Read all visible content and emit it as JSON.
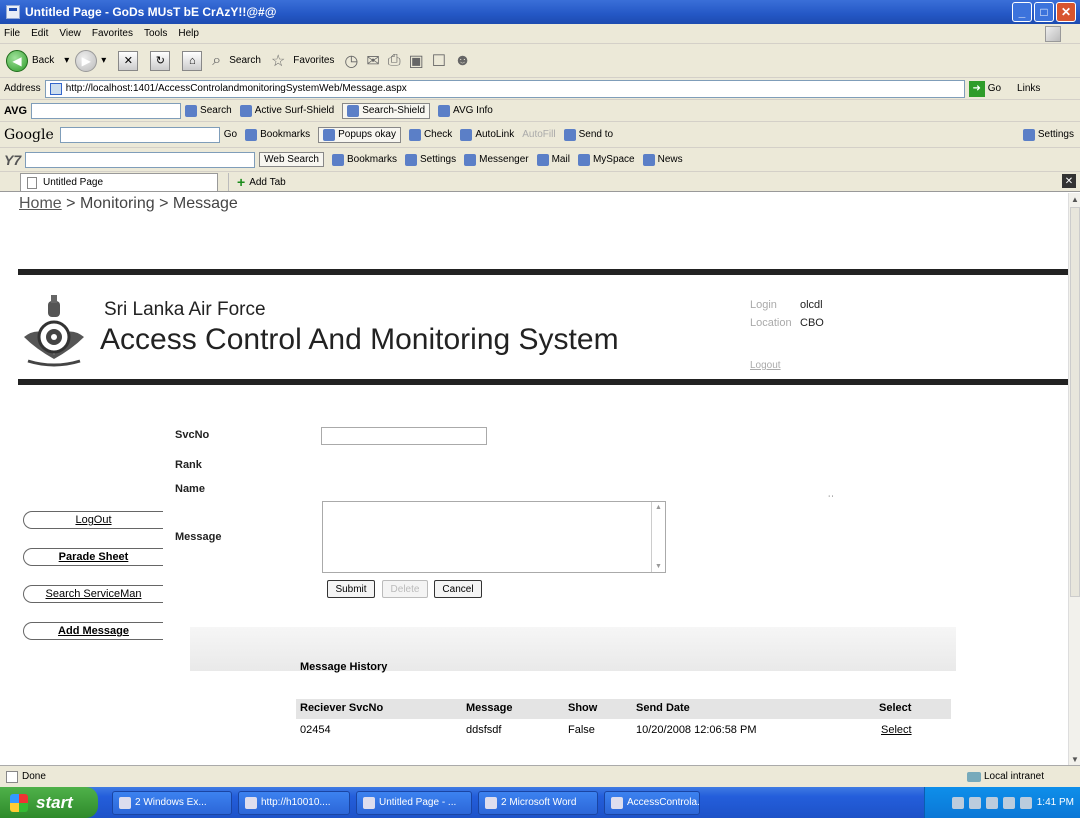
{
  "window": {
    "title": "Untitled Page - GoDs MUsT bE CrAzY!!@#@"
  },
  "menu": [
    "File",
    "Edit",
    "View",
    "Favorites",
    "Tools",
    "Help"
  ],
  "toolbar": {
    "back": "Back",
    "search": "Search",
    "favorites": "Favorites"
  },
  "address": {
    "label": "Address",
    "url": "http://localhost:1401/AccessControlandmonitoringSystemWeb/Message.aspx",
    "go": "Go",
    "links": "Links"
  },
  "avg_bar": {
    "logo": "AVG",
    "search": "Search",
    "active_surf": "Active Surf-Shield",
    "search_shield": "Search-Shield",
    "avg_info": "AVG Info"
  },
  "google_bar": {
    "logo": "Google",
    "go": "Go",
    "bookmarks": "Bookmarks",
    "popups": "Popups okay",
    "check": "Check",
    "autolink": "AutoLink",
    "autofill": "AutoFill",
    "send_to": "Send to",
    "settings": "Settings"
  },
  "yahoo_bar": {
    "web_search": "Web Search",
    "bookmarks": "Bookmarks",
    "settings": "Settings",
    "messenger": "Messenger",
    "mail": "Mail",
    "myspace": "MySpace",
    "news": "News"
  },
  "tabs": {
    "active": "Untitled Page",
    "add": "Add Tab"
  },
  "breadcrumb": {
    "home": "Home",
    "monitoring": "Monitoring",
    "current": "Message",
    "sep": ">"
  },
  "header": {
    "org": "Sri Lanka Air Force",
    "system": "Access Control And Monitoring System",
    "login_label": "Login",
    "login_value": "olcdl",
    "location_label": "Location",
    "location_value": "CBO",
    "logout": "Logout"
  },
  "sidebar": {
    "items": [
      "LogOut",
      "Parade Sheet",
      "Search ServiceMan",
      "Add Message"
    ]
  },
  "form": {
    "svcno_label": "SvcNo",
    "rank_label": "Rank",
    "name_label": "Name",
    "message_label": "Message",
    "svcno_value": "",
    "message_value": "",
    "submit": "Submit",
    "delete": "Delete",
    "cancel": "Cancel"
  },
  "history": {
    "title": "Message History",
    "columns": [
      "Reciever SvcNo",
      "Message",
      "Show",
      "Send Date",
      "Select"
    ],
    "rows": [
      [
        "02454",
        "ddsfsdf",
        "False",
        "10/20/2008 12:06:58 PM",
        "Select"
      ]
    ]
  },
  "status": {
    "left": "Done",
    "zone": "Local intranet"
  },
  "taskbar": {
    "start": "start",
    "tasks": [
      "2 Windows Ex...",
      "http://h10010....",
      "Untitled Page - ...",
      "2 Microsoft Word",
      "AccessControla..."
    ],
    "clock": "1:41 PM"
  }
}
